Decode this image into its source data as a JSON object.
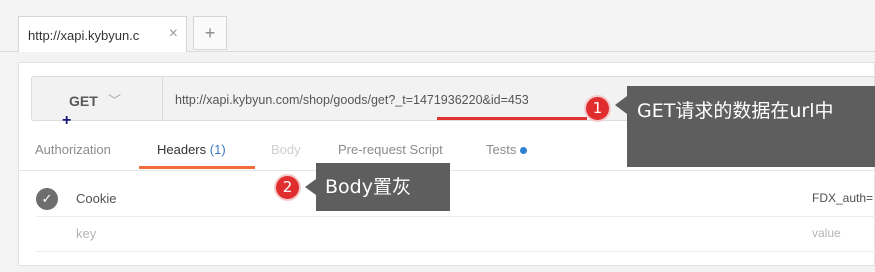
{
  "tabs": [
    {
      "title": "http://xapi.kybyun.c",
      "close_icon": "close-icon"
    }
  ],
  "new_tab_label": "+",
  "request": {
    "method": "GET",
    "url": "http://xapi.kybyun.com/shop/goods/get?_t=1471936220&id=453"
  },
  "marker": "+",
  "subtabs": [
    {
      "label": "Authorization"
    },
    {
      "label": "Headers",
      "count": "(1)"
    },
    {
      "label": "Body"
    },
    {
      "label": "Pre-request Script"
    },
    {
      "label": "Tests"
    }
  ],
  "headers_table": [
    {
      "enabled": true,
      "key": "Cookie",
      "value": "FDX_auth="
    },
    {
      "enabled": false,
      "key": "key",
      "value": "value"
    }
  ],
  "annotations": [
    {
      "number": "1",
      "text": "GET请求的数据在url中"
    },
    {
      "number": "2",
      "text": "Body置灰"
    }
  ],
  "colors": {
    "accent": "#f26b3a",
    "badge": "#e02e2e",
    "callout": "#5e5e5e",
    "tests_dot": "#2f80d0"
  }
}
